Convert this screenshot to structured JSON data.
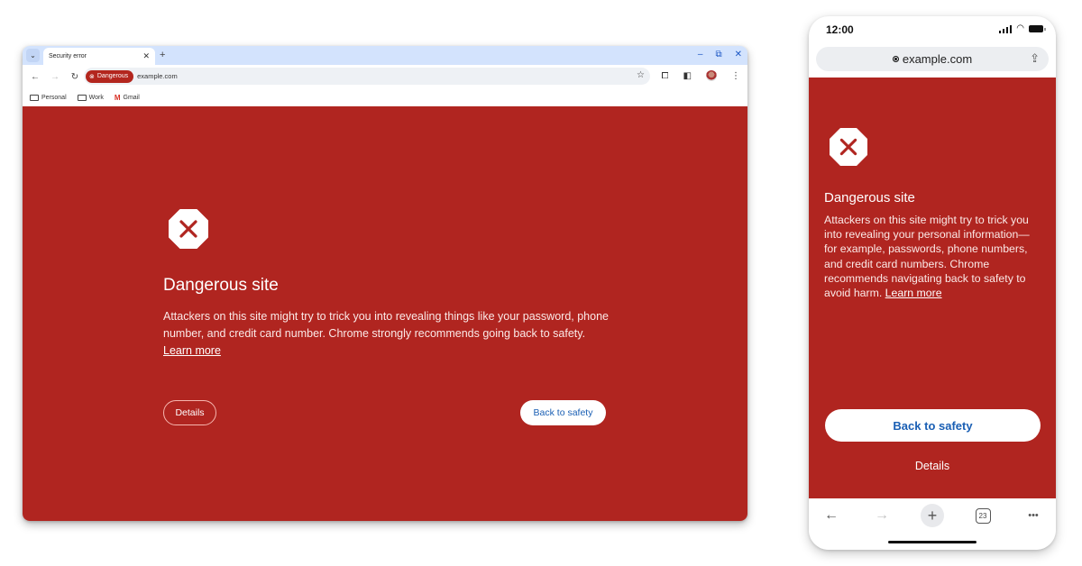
{
  "colors": {
    "danger_red": "#b02520",
    "chip_red": "#b3261e",
    "link_blue": "#1a5fb4",
    "tabstrip_blue": "#d3e3fd"
  },
  "desktop": {
    "tab": {
      "title": "Security error",
      "close_icon": "close-icon"
    },
    "new_tab_icon": "+",
    "window_controls": {
      "minimize": "–",
      "restore": "⧉",
      "close": "✕"
    },
    "toolbar": {
      "back_icon": "←",
      "forward_icon": "→",
      "reload_icon": "↻",
      "security_chip": {
        "icon": "⊗",
        "label": "Dangerous"
      },
      "url": "example.com",
      "star_icon": "☆",
      "extensions_icon": "⧠",
      "sidepanel_icon": "◧",
      "menu_icon": "⋮"
    },
    "bookmarks": [
      {
        "label": "Personal",
        "icon": "folder-icon"
      },
      {
        "label": "Work",
        "icon": "folder-icon"
      },
      {
        "label": "Gmail",
        "icon": "gmail-icon",
        "glyph": "M"
      }
    ],
    "interstitial": {
      "title": "Dangerous site",
      "body": "Attackers on this site might try to trick you into revealing things like your password, phone number, and credit card number. Chrome strongly recommends going back to safety.",
      "learn_more": "Learn more",
      "details_button": "Details",
      "back_button": "Back to safety"
    }
  },
  "mobile": {
    "status_bar": {
      "time": "12:00"
    },
    "address_bar": {
      "url": "example.com",
      "share_icon": "⇪"
    },
    "interstitial": {
      "title": "Dangerous site",
      "body": "Attackers on this site might try to trick you into revealing your personal information—for example, passwords, phone numbers, and credit card numbers. Chrome recommends navigating back to safety to avoid harm.",
      "learn_more": "Learn more",
      "back_button": "Back to safety",
      "details_button": "Details"
    },
    "bottom_bar": {
      "back_icon": "←",
      "forward_icon": "→",
      "new_tab_icon": "+",
      "tab_count": "23",
      "more_icon": "•••"
    }
  }
}
